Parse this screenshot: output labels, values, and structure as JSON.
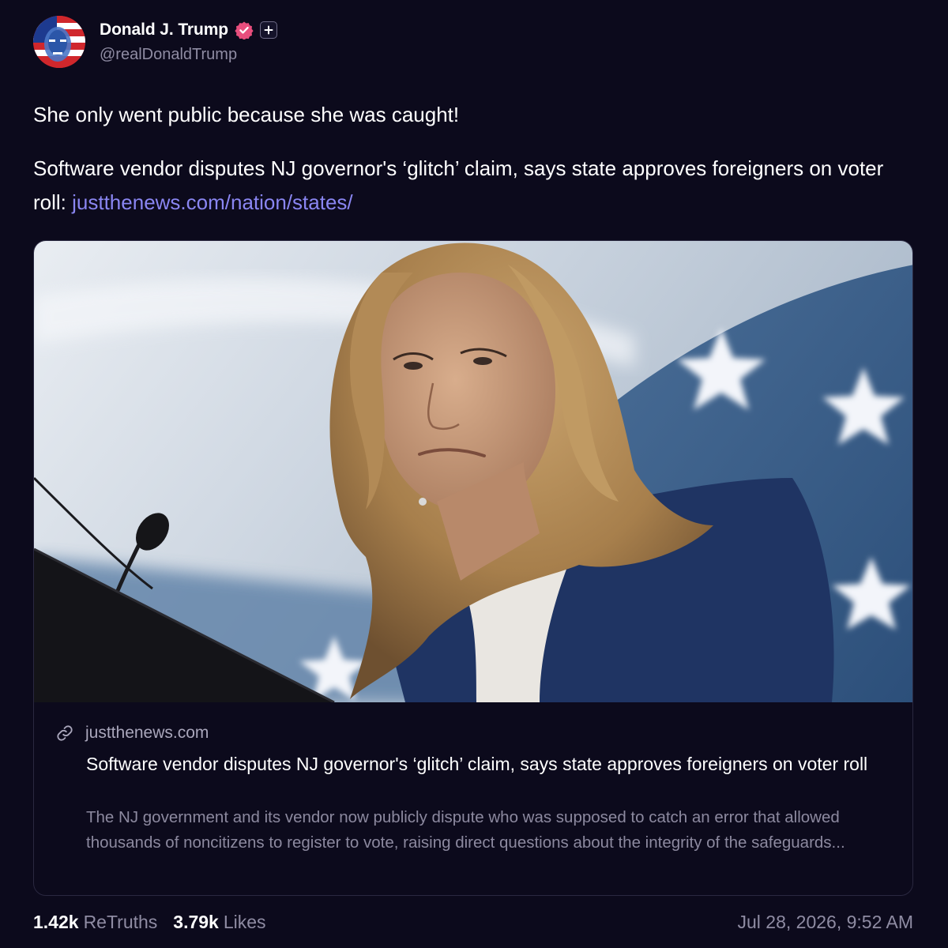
{
  "author": {
    "display_name": "Donald J. Trump",
    "handle": "@realDonaldTrump",
    "verified_icon": "verified-badge-icon",
    "badge_icon": "plus-badge-icon",
    "accent_color": "#e84e7d"
  },
  "post": {
    "text_line1": "She only went public because she was caught!",
    "text_line2": "Software vendor disputes NJ governor's ‘glitch’ claim, says state approves foreigners on voter roll: ",
    "link_text": "justthenews.com/nation/states/",
    "link_color": "#8a86f2"
  },
  "card": {
    "image_icon": "woman-at-podium-photo",
    "domain_icon": "link-icon",
    "domain": "justthenews.com",
    "title": "Software vendor disputes NJ governor's ‘glitch’ claim, says state approves foreigners on voter roll",
    "description": "The NJ government and its vendor now publicly dispute who was supposed to catch an error that allowed thousands of noncitizens to register to vote, raising direct questions about the integrity of the safeguards..."
  },
  "stats": {
    "retruths_count": "1.42k",
    "retruths_label": "ReTruths",
    "likes_count": "3.79k",
    "likes_label": "Likes",
    "timestamp": "Jul 28, 2026, 9:52 AM"
  }
}
